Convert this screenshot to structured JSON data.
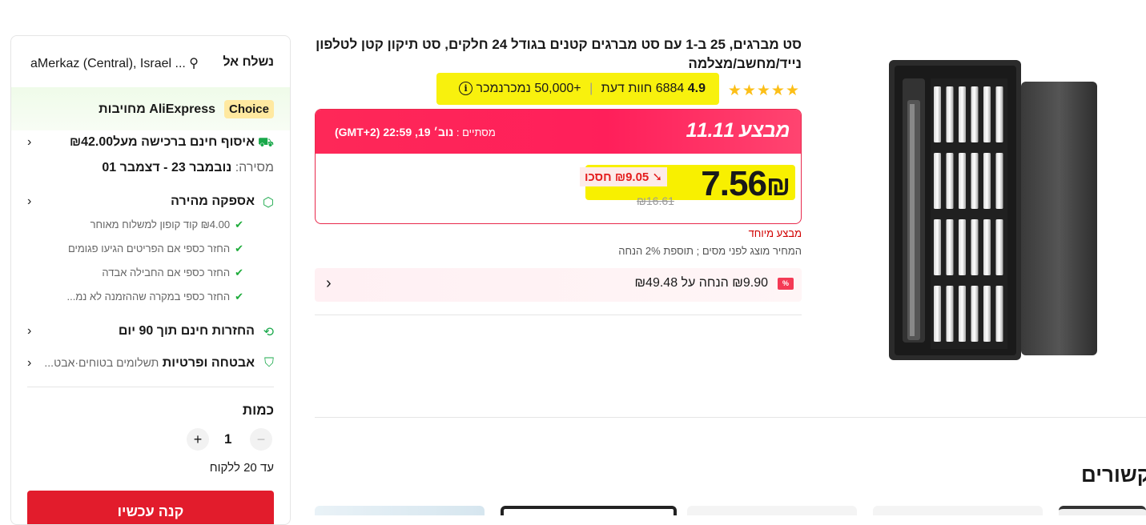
{
  "product": {
    "title": "סט מברגים, 25 ב-1 עם סט מברגים קטנים בגודל 24 חלקים, סט תיקון קטן לטלפון נייד/מחשב/מצלמה",
    "stars": "★★★★★",
    "rating": "4.9",
    "reviews": "6884 חוות דעת",
    "sold": "+50,000 נמכרנמכר"
  },
  "deal": {
    "name": "מבצע 11.11",
    "ends_label": "מסתיים :",
    "ends_time": "נוב׳ 19, 22:59 (GMT+2)",
    "price_value": "7.56",
    "price_currency": "₪",
    "save": "₪9.05 חסכו",
    "original_price": "₪16.61",
    "special": "מבצע מיוחד",
    "tax_note": "המחיר מוצג לפני מסים ; תוספת 2% הנחה"
  },
  "coupon": {
    "icon": "%",
    "text": "₪9.90 הנחה על ₪49.48"
  },
  "related": {
    "title": "קשורים"
  },
  "shipping": {
    "label": "נשלח אל",
    "location": "aMerkaz (Central), Israel ...",
    "choice_badge": "Choice",
    "choice_text": "AliExpress מחויבות",
    "free_shipping": "איסוף חינם ברכישה מעל₪42.00",
    "delivery_label": "מסירה:",
    "delivery_dates": "נובמבר 23 - דצמבר 01",
    "fast_delivery": "אספקה מהירה",
    "checks": [
      "₪4.00 קוד קופון למשלוח מאוחר",
      "החזר כספי אם הפריטים הגיעו פגומים",
      "החזר כספי אם החבילה אבדה",
      "החזר כספי במקרה שההזמנה לא נמ..."
    ],
    "returns": "החזרות חינם תוך 90 יום",
    "security": "אבטחה ופרטיות",
    "security_sub": "תשלומים בטוחים·אבט..."
  },
  "quantity": {
    "label": "כמות",
    "value": "1",
    "limit": "עד 20 ללקוח",
    "minus": "−",
    "plus": "+"
  },
  "buy_button": "קנה עכשיו",
  "colors": {
    "accent": "#fe2858",
    "highlight": "#f8f000",
    "buy": "#e21c2c"
  }
}
